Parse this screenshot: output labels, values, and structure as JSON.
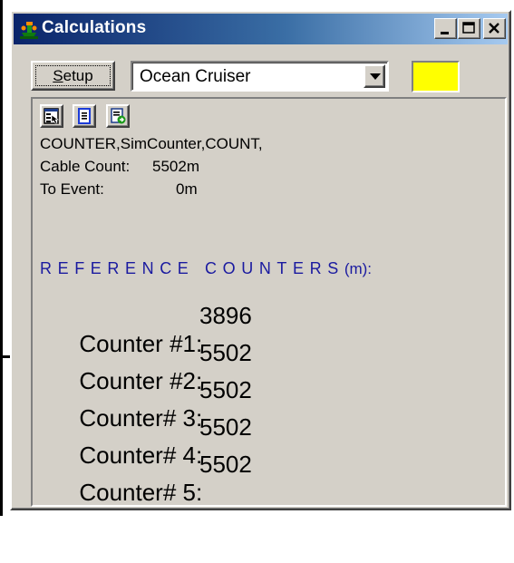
{
  "window": {
    "title": "Calculations",
    "controls": {
      "minimize": "minimize",
      "maximize": "maximize",
      "close": "close"
    }
  },
  "toolbar": {
    "setup_label_underlined": "S",
    "setup_label_rest": "etup",
    "vessel_select": {
      "selected": "Ocean Cruiser"
    },
    "status_color": "#ffff00"
  },
  "panel": {
    "tool_icons": [
      "properties-icon",
      "document-icon",
      "export-icon"
    ],
    "counter_source": "COUNTER,SimCounter,COUNT,",
    "cable_count": {
      "label": "Cable Count:",
      "value": "5502m"
    },
    "to_event": {
      "label": "To Event:",
      "value": "0m"
    },
    "reference_heading": {
      "text": "REFERENCE COUNTERS",
      "unit": "(m):"
    },
    "counters": [
      {
        "label": "Counter #1:",
        "value": "3896"
      },
      {
        "label": "Counter #2:",
        "value": "5502"
      },
      {
        "label": "Counter# 3:",
        "value": "5502"
      },
      {
        "label": "Counter# 4:",
        "value": "5502"
      },
      {
        "label": "Counter# 5:",
        "value": "5502"
      }
    ]
  }
}
